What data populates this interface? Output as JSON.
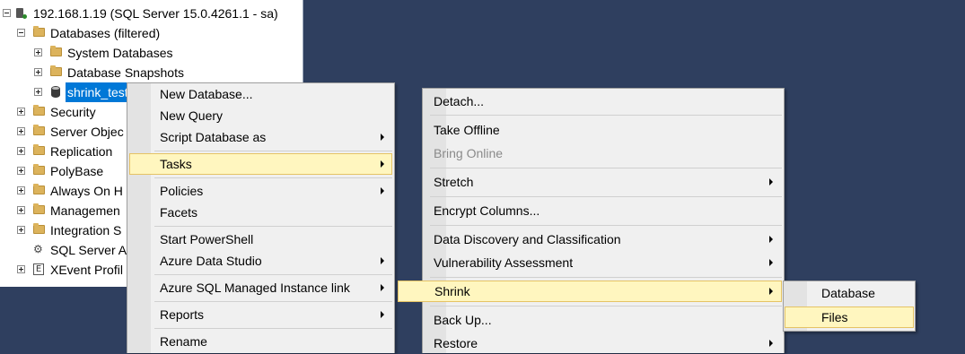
{
  "tree": {
    "server": "192.168.1.19 (SQL Server 15.0.4261.1 - sa)",
    "databases": "Databases (filtered)",
    "system_databases": "System Databases",
    "database_snapshots": "Database Snapshots",
    "selected_db": "shrink_test",
    "security": "Security",
    "server_objects": "Server Objec",
    "replication": "Replication",
    "polybase": "PolyBase",
    "always_on": "Always On H",
    "management": "Managemen",
    "integration": "Integration S",
    "agent": "SQL Server A",
    "xevent": "XEvent Profil"
  },
  "menu1": {
    "new_database": "New Database...",
    "new_query": "New Query",
    "script_database": "Script Database as",
    "tasks": "Tasks",
    "policies": "Policies",
    "facets": "Facets",
    "start_powershell": "Start PowerShell",
    "azure_data_studio": "Azure Data Studio",
    "azure_sql_mi_link": "Azure SQL Managed Instance link",
    "reports": "Reports",
    "rename": "Rename"
  },
  "menu2": {
    "detach": "Detach...",
    "take_offline": "Take Offline",
    "bring_online": "Bring Online",
    "stretch": "Stretch",
    "encrypt_columns": "Encrypt Columns...",
    "data_discovery": "Data Discovery and Classification",
    "vulnerability": "Vulnerability Assessment",
    "shrink": "Shrink",
    "back_up": "Back Up...",
    "restore": "Restore"
  },
  "menu3": {
    "database": "Database",
    "files": "Files"
  },
  "icons": {
    "server": "server-icon",
    "folder": "folder-icon",
    "database": "database-icon",
    "submenu_arrow": "chevron-right-icon"
  }
}
